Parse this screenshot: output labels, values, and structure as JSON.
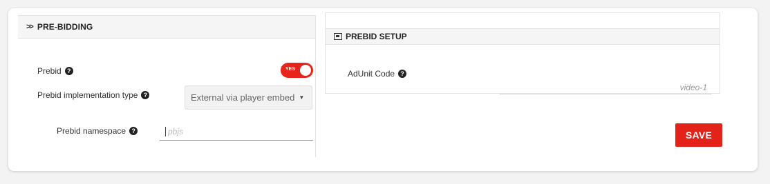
{
  "left_panel": {
    "header": "PRE-BIDDING",
    "prebid": {
      "label": "Prebid",
      "toggle_text": "YES"
    },
    "impl_type": {
      "label": "Prebid implementation type",
      "selected": "External via player embed"
    },
    "namespace": {
      "label": "Prebid namespace",
      "placeholder": "pbjs"
    }
  },
  "right_panel": {
    "header": "PREBID SETUP",
    "adunit": {
      "label": "AdUnit Code",
      "value": "video-1"
    }
  },
  "save_label": "SAVE",
  "colors": {
    "accent": "#e3231a",
    "focus": "#4aa3df"
  }
}
